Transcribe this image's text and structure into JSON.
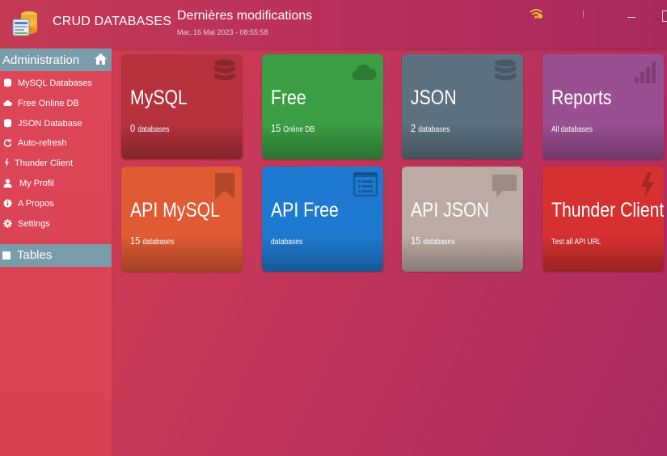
{
  "header": {
    "app_title": "CRUD DATABASES",
    "page_title": "Dernières modifications",
    "timestamp": "Mar, 16 Mai 2023 - 08:55:58"
  },
  "sidebar": {
    "section_title": "Administration",
    "items": [
      {
        "label": "MySQL Databases",
        "icon": "database-icon"
      },
      {
        "label": "Free Online DB",
        "icon": "cloud-icon"
      },
      {
        "label": "JSON Database",
        "icon": "database-icon"
      },
      {
        "label": "Auto-refresh",
        "icon": "refresh-icon"
      },
      {
        "label": "Thunder Client",
        "icon": "bolt-icon"
      },
      {
        "label": "My Profil",
        "icon": "user-icon"
      },
      {
        "label": "A Propos",
        "icon": "info-icon"
      },
      {
        "label": "Settings",
        "icon": "gear-icon"
      }
    ],
    "tables_title": "Tables"
  },
  "tiles": [
    {
      "name": "MySQL",
      "count": "0",
      "unit": "databases",
      "icon": "database-icon",
      "color": "#b5323d"
    },
    {
      "name": "Free",
      "count": "15",
      "unit": "Online DB",
      "icon": "cloud-icon",
      "color": "#3b9e45"
    },
    {
      "name": "JSON",
      "count": "2",
      "unit": "databases",
      "icon": "database-icon",
      "color": "#5d7180"
    },
    {
      "name": "Reports",
      "count": "",
      "unit": "All databases",
      "icon": "bar-chart-icon",
      "color": "#9b4f93"
    },
    {
      "name": "API MySQL",
      "count": "15",
      "unit": "databases",
      "icon": "bookmark-icon",
      "color": "#e05a33"
    },
    {
      "name": "API Free",
      "count": "",
      "unit": "databases",
      "icon": "list-icon",
      "color": "#1e7ad0"
    },
    {
      "name": "API JSON",
      "count": "15",
      "unit": "databases",
      "icon": "comment-icon",
      "color": "#bcaba2"
    },
    {
      "name": "Thunder Client",
      "count": "",
      "unit": "Test all API URL",
      "icon": "bolt-icon",
      "color": "#d73030"
    }
  ]
}
